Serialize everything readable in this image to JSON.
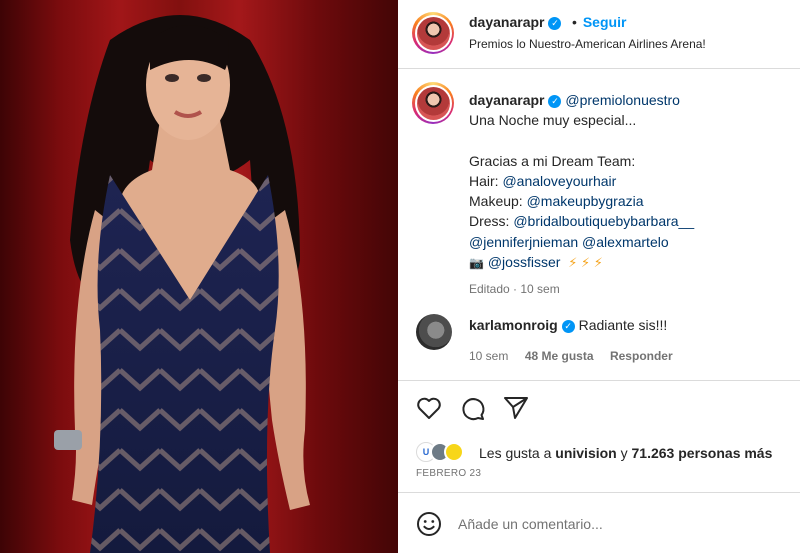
{
  "post": {
    "username": "dayanarapr",
    "follow_label": "Seguir",
    "location": "Premios lo Nuestro-American Airlines Arena!"
  },
  "caption": {
    "username": "dayanarapr",
    "mention": "@premiolonuestro",
    "line1": "Una Noche muy especial...",
    "line2": "Gracias a mi Dream Team:",
    "hair_label": "Hair: ",
    "hair_handle": "@analoveyourhair",
    "makeup_label": "Makeup: ",
    "makeup_handle": "@makeupbygrazia",
    "dress_label": "Dress: ",
    "dress_handle": "@bridalboutiquebybarbara__",
    "handle_jennifer": "@jenniferjnieman",
    "handle_alex": "@alexmartelo",
    "camera_emoji": "📷",
    "photo_handle": "@jossfisser",
    "bolts": "⚡ ⚡ ⚡",
    "edited": "Editado · 10 sem"
  },
  "comment": {
    "username": "karlamonroig",
    "text": "Radiante sis!!!",
    "age": "10 sem",
    "likes": "48 Me gusta",
    "reply_label": "Responder"
  },
  "likes": {
    "prefix": "Les gusta a ",
    "liker": "univision",
    "middle": " y ",
    "count": "71.263 personas más"
  },
  "date": "FEBRERO 23",
  "composer": {
    "placeholder": "Añade un comentario..."
  },
  "icons": {
    "heart": "heart-icon",
    "comment": "comment-icon",
    "share": "share-icon",
    "emoji": "emoji-icon",
    "verified": "verified-badge-icon"
  },
  "colors": {
    "accent": "#0095f6",
    "link": "#00376b",
    "muted": "#737373"
  }
}
